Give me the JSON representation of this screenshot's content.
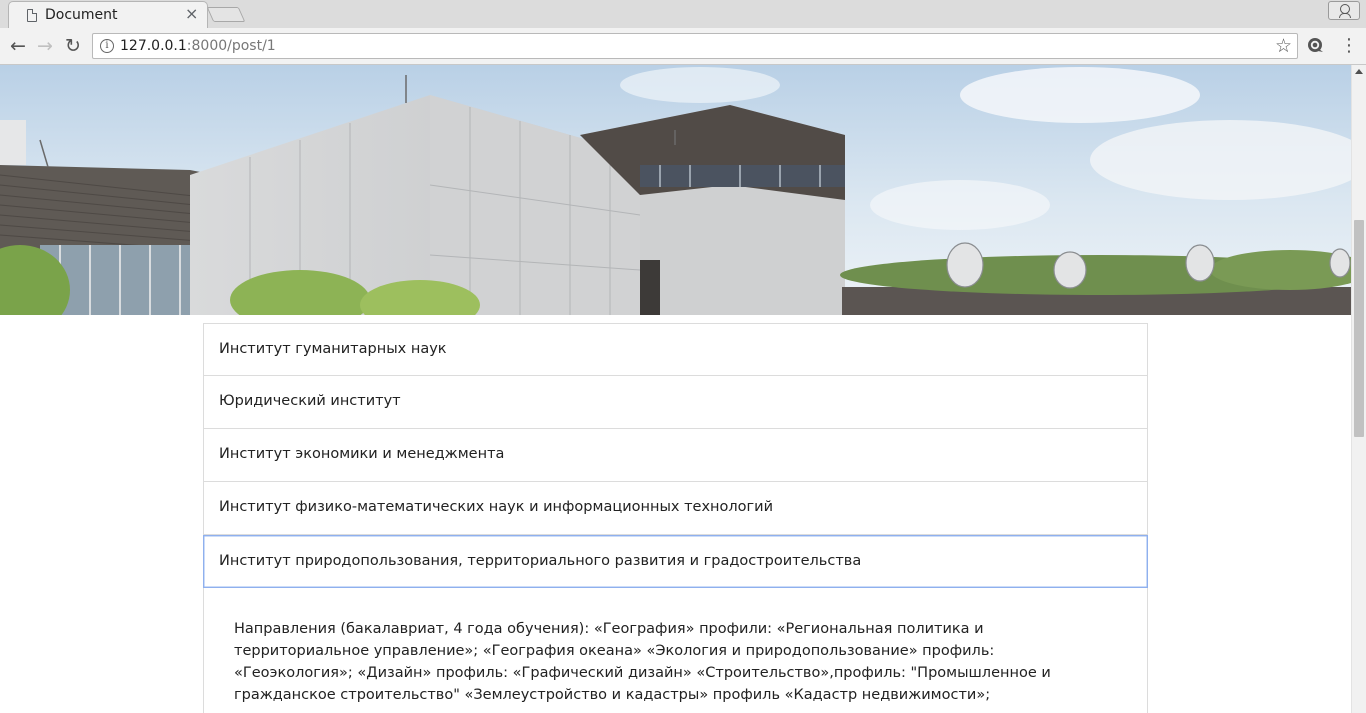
{
  "browser": {
    "tab_title": "Document",
    "tab_close": "×",
    "url_host": "127.0.0.1",
    "url_path": ":8000/post/1",
    "icons": {
      "back": "arrow-left",
      "forward": "arrow-right",
      "reload": "reload",
      "site_info": "info-circle",
      "bookmark": "star-outline",
      "menu": "three-dots-vertical",
      "profile": "person"
    }
  },
  "institutes": [
    {
      "label": "Институт гуманитарных наук"
    },
    {
      "label": "Юридический институт"
    },
    {
      "label": "Институт экономики и менеджмента"
    },
    {
      "label": "Институт физико-математических наук и информационных технологий"
    },
    {
      "label": "Институт природопользования, территориального развития и градостроительства"
    }
  ],
  "active_index": 4,
  "expanded_text": "Направления (бакалавриат, 4 года обучения): «География» профили: «Региональная политика и территориальное управление»; «География океана» «Экология и природопользование» профиль: «Геоэкология»; «Дизайн» профиль: «Графический дизайн» «Строительство»,профиль: \"Промышленное и гражданское строительство\" «Землеустройство и кадастры» профиль «Кадастр недвижимости»;"
}
